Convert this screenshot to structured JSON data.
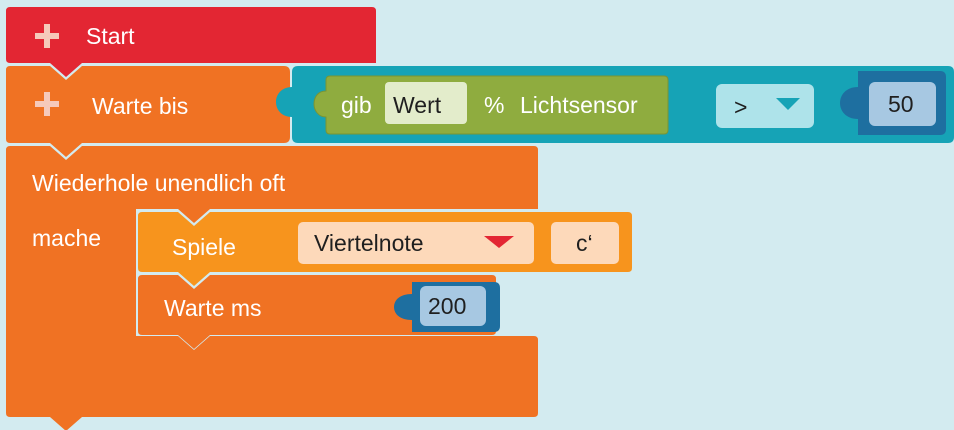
{
  "colors": {
    "background": "#d3ebf0",
    "event_red": "#e32633",
    "control_orange": "#f07223",
    "sound_orange": "#f7941d",
    "logic_teal": "#16a3b6",
    "sensor_green": "#8fac3f",
    "number_blue": "#1e6fa0"
  },
  "start_block": {
    "label": "Start",
    "icon": "plus-icon"
  },
  "wait_until_block": {
    "label": "Warte bis",
    "icon": "plus-icon",
    "compare": {
      "operator": ">",
      "left": {
        "prefix": "gib",
        "field": "Wert",
        "separator": "%",
        "sensor": "Lichtsensor"
      },
      "right": "50"
    }
  },
  "loop_block": {
    "label": "Wiederhole unendlich oft",
    "do_label": "mache",
    "play_block": {
      "label": "Spiele",
      "duration": "Viertelnote",
      "note": "c‘"
    },
    "wait_block": {
      "label": "Warte ms",
      "value": "200"
    }
  }
}
